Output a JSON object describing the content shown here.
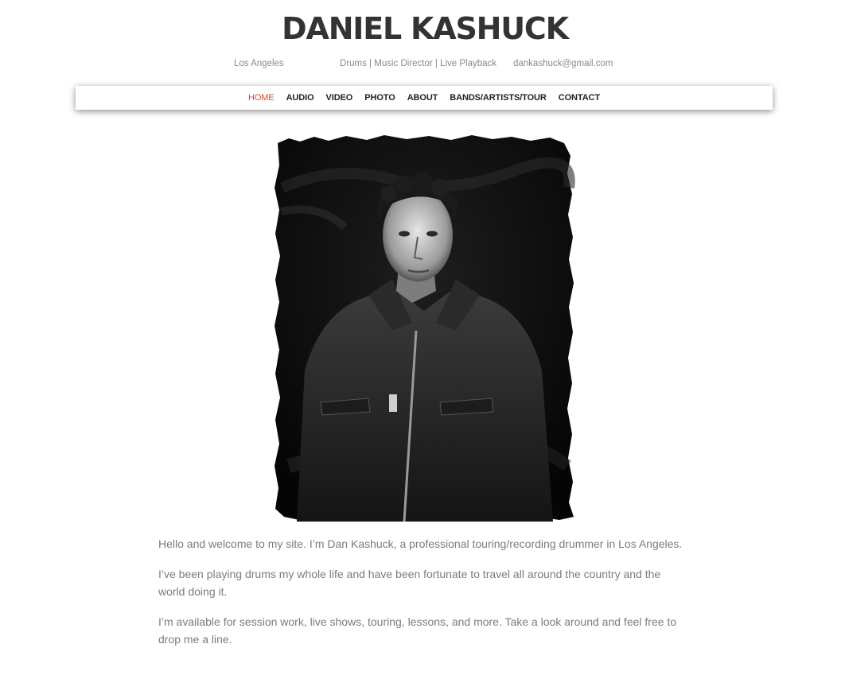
{
  "header": {
    "title": "DANIEL KASHUCK",
    "location": "Los Angeles",
    "roles": "Drums | Music Director | Live Playback",
    "email": "dankashuck@gmail.com"
  },
  "nav": {
    "items": [
      {
        "label": "HOME",
        "active": true
      },
      {
        "label": "AUDIO",
        "active": false
      },
      {
        "label": "VIDEO",
        "active": false
      },
      {
        "label": "PHOTO",
        "active": false
      },
      {
        "label": "ABOUT",
        "active": false
      },
      {
        "label": "BANDS/ARTISTS/TOUR",
        "active": false
      },
      {
        "label": "CONTACT",
        "active": false
      }
    ],
    "active_color": "#e0442f"
  },
  "hero_image": {
    "subject": "black-and-white portrait photo with distressed border"
  },
  "intro": {
    "paragraphs": [
      "Hello and welcome to my site. I’m Dan Kashuck, a professional touring/recording drummer in Los Angeles.",
      "I’ve been playing drums my whole life and have been fortunate to travel all around the country and the world doing it.",
      "I’m available for session work, live shows, touring, lessons, and more. Take a look around and feel free to drop me a line."
    ]
  }
}
